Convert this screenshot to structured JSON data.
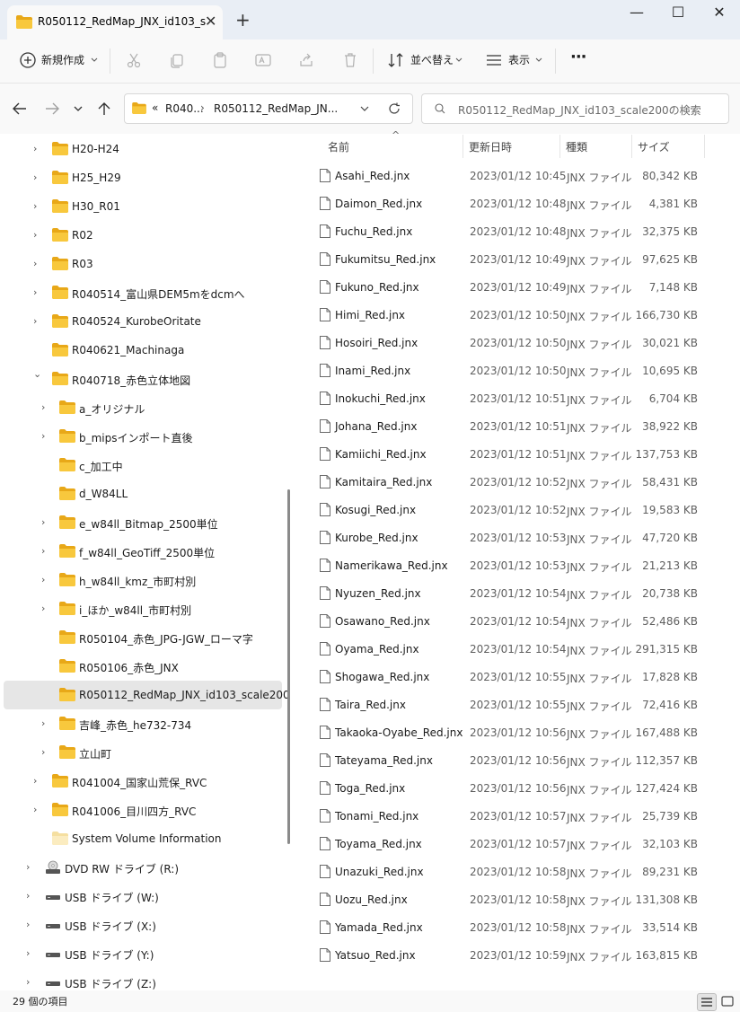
{
  "window": {
    "tab_title": "R050112_RedMap_JNX_id103_s",
    "tab_close": "✕",
    "new_tab": "+",
    "minimize": "—",
    "maximize": "☐",
    "close": "✕"
  },
  "toolbar": {
    "new_label": "新規作成",
    "sort_label": "並べ替え",
    "view_label": "表示",
    "more_label": "···"
  },
  "address": {
    "prefix": "«",
    "crumb1": "R040...",
    "sep": "›",
    "crumb2": "R050112_RedMap_JN..."
  },
  "search": {
    "placeholder": "R050112_RedMap_JNX_id103_scale200の検索"
  },
  "nav_tree": [
    {
      "label": "H20-H24",
      "depth": 0,
      "chevron": "›"
    },
    {
      "label": "H25_H29",
      "depth": 0,
      "chevron": "›"
    },
    {
      "label": "H30_R01",
      "depth": 0,
      "chevron": "›"
    },
    {
      "label": "R02",
      "depth": 0,
      "chevron": "›"
    },
    {
      "label": "R03",
      "depth": 0,
      "chevron": "›"
    },
    {
      "label": "R040514_富山県DEM5mをdcmへ",
      "depth": 0,
      "chevron": "›"
    },
    {
      "label": "R040524_KurobeOritate",
      "depth": 0,
      "chevron": "›"
    },
    {
      "label": "R040621_Machinaga",
      "depth": 0,
      "chevron": ""
    },
    {
      "label": "R040718_赤色立体地図",
      "depth": 0,
      "chevron": "⌄"
    },
    {
      "label": "a_オリジナル",
      "depth": 1,
      "chevron": "›"
    },
    {
      "label": "b_mipsインポート直後",
      "depth": 1,
      "chevron": "›"
    },
    {
      "label": "c_加工中",
      "depth": 1,
      "chevron": ""
    },
    {
      "label": "d_W84LL",
      "depth": 1,
      "chevron": ""
    },
    {
      "label": "e_w84ll_Bitmap_2500単位",
      "depth": 1,
      "chevron": "›"
    },
    {
      "label": "f_w84ll_GeoTiff_2500単位",
      "depth": 1,
      "chevron": "›"
    },
    {
      "label": "h_w84ll_kmz_市町村別",
      "depth": 1,
      "chevron": "›"
    },
    {
      "label": "i_ほか_w84ll_市町村別",
      "depth": 1,
      "chevron": "›"
    },
    {
      "label": "R050104_赤色_JPG-JGW_ローマ字",
      "depth": 1,
      "chevron": ""
    },
    {
      "label": "R050106_赤色_JNX",
      "depth": 1,
      "chevron": ""
    },
    {
      "label": "R050112_RedMap_JNX_id103_scale200",
      "depth": 1,
      "chevron": "",
      "selected": true
    },
    {
      "label": "吉峰_赤色_he732-734",
      "depth": 1,
      "chevron": "›"
    },
    {
      "label": "立山町",
      "depth": 1,
      "chevron": "›"
    },
    {
      "label": "R041004_国家山荒保_RVC",
      "depth": 0,
      "chevron": "›"
    },
    {
      "label": "R041006_目川四方_RVC",
      "depth": 0,
      "chevron": "›"
    },
    {
      "label": "System Volume Information",
      "depth": 0,
      "chevron": "",
      "pale": true
    },
    {
      "label": "DVD RW ドライブ (R:)",
      "depth": -1,
      "chevron": "›",
      "drive": "dvd"
    },
    {
      "label": "USB ドライブ (W:)",
      "depth": -1,
      "chevron": "›",
      "drive": "usb"
    },
    {
      "label": "USB ドライブ (X:)",
      "depth": -1,
      "chevron": "›",
      "drive": "usb"
    },
    {
      "label": "USB ドライブ (Y:)",
      "depth": -1,
      "chevron": "›",
      "drive": "usb"
    },
    {
      "label": "USB ドライブ (Z:)",
      "depth": -1,
      "chevron": "›",
      "drive": "usb"
    }
  ],
  "columns": {
    "name": "名前",
    "date": "更新日時",
    "type": "種類",
    "size": "サイズ",
    "sort_indicator": "^"
  },
  "files": [
    {
      "name": "Asahi_Red.jnx",
      "date": "2023/01/12 10:45",
      "type": "JNX ファイル",
      "size": "80,342 KB"
    },
    {
      "name": "Daimon_Red.jnx",
      "date": "2023/01/12 10:48",
      "type": "JNX ファイル",
      "size": "4,381 KB"
    },
    {
      "name": "Fuchu_Red.jnx",
      "date": "2023/01/12 10:48",
      "type": "JNX ファイル",
      "size": "32,375 KB"
    },
    {
      "name": "Fukumitsu_Red.jnx",
      "date": "2023/01/12 10:49",
      "type": "JNX ファイル",
      "size": "97,625 KB"
    },
    {
      "name": "Fukuno_Red.jnx",
      "date": "2023/01/12 10:49",
      "type": "JNX ファイル",
      "size": "7,148 KB"
    },
    {
      "name": "Himi_Red.jnx",
      "date": "2023/01/12 10:50",
      "type": "JNX ファイル",
      "size": "166,730 KB"
    },
    {
      "name": "Hosoiri_Red.jnx",
      "date": "2023/01/12 10:50",
      "type": "JNX ファイル",
      "size": "30,021 KB"
    },
    {
      "name": "Inami_Red.jnx",
      "date": "2023/01/12 10:50",
      "type": "JNX ファイル",
      "size": "10,695 KB"
    },
    {
      "name": "Inokuchi_Red.jnx",
      "date": "2023/01/12 10:51",
      "type": "JNX ファイル",
      "size": "6,704 KB"
    },
    {
      "name": "Johana_Red.jnx",
      "date": "2023/01/12 10:51",
      "type": "JNX ファイル",
      "size": "38,922 KB"
    },
    {
      "name": "Kamiichi_Red.jnx",
      "date": "2023/01/12 10:51",
      "type": "JNX ファイル",
      "size": "137,753 KB"
    },
    {
      "name": "Kamitaira_Red.jnx",
      "date": "2023/01/12 10:52",
      "type": "JNX ファイル",
      "size": "58,431 KB"
    },
    {
      "name": "Kosugi_Red.jnx",
      "date": "2023/01/12 10:52",
      "type": "JNX ファイル",
      "size": "19,583 KB"
    },
    {
      "name": "Kurobe_Red.jnx",
      "date": "2023/01/12 10:53",
      "type": "JNX ファイル",
      "size": "47,720 KB"
    },
    {
      "name": "Namerikawa_Red.jnx",
      "date": "2023/01/12 10:53",
      "type": "JNX ファイル",
      "size": "21,213 KB"
    },
    {
      "name": "Nyuzen_Red.jnx",
      "date": "2023/01/12 10:54",
      "type": "JNX ファイル",
      "size": "20,738 KB"
    },
    {
      "name": "Osawano_Red.jnx",
      "date": "2023/01/12 10:54",
      "type": "JNX ファイル",
      "size": "52,486 KB"
    },
    {
      "name": "Oyama_Red.jnx",
      "date": "2023/01/12 10:54",
      "type": "JNX ファイル",
      "size": "291,315 KB"
    },
    {
      "name": "Shogawa_Red.jnx",
      "date": "2023/01/12 10:55",
      "type": "JNX ファイル",
      "size": "17,828 KB"
    },
    {
      "name": "Taira_Red.jnx",
      "date": "2023/01/12 10:55",
      "type": "JNX ファイル",
      "size": "72,416 KB"
    },
    {
      "name": "Takaoka-Oyabe_Red.jnx",
      "date": "2023/01/12 10:56",
      "type": "JNX ファイル",
      "size": "167,488 KB"
    },
    {
      "name": "Tateyama_Red.jnx",
      "date": "2023/01/12 10:56",
      "type": "JNX ファイル",
      "size": "112,357 KB"
    },
    {
      "name": "Toga_Red.jnx",
      "date": "2023/01/12 10:56",
      "type": "JNX ファイル",
      "size": "127,424 KB"
    },
    {
      "name": "Tonami_Red.jnx",
      "date": "2023/01/12 10:57",
      "type": "JNX ファイル",
      "size": "25,739 KB"
    },
    {
      "name": "Toyama_Red.jnx",
      "date": "2023/01/12 10:57",
      "type": "JNX ファイル",
      "size": "32,103 KB"
    },
    {
      "name": "Unazuki_Red.jnx",
      "date": "2023/01/12 10:58",
      "type": "JNX ファイル",
      "size": "89,231 KB"
    },
    {
      "name": "Uozu_Red.jnx",
      "date": "2023/01/12 10:58",
      "type": "JNX ファイル",
      "size": "131,308 KB"
    },
    {
      "name": "Yamada_Red.jnx",
      "date": "2023/01/12 10:58",
      "type": "JNX ファイル",
      "size": "33,514 KB"
    },
    {
      "name": "Yatsuo_Red.jnx",
      "date": "2023/01/12 10:59",
      "type": "JNX ファイル",
      "size": "163,815 KB"
    }
  ],
  "status": {
    "item_count": "29 個の項目"
  },
  "colors": {
    "folder": "#f8c83d",
    "folder_dark": "#e8a818",
    "selected_row": "#e6e6e6",
    "chrome": "#f9f9f9",
    "titlebar": "#e9eef5"
  }
}
